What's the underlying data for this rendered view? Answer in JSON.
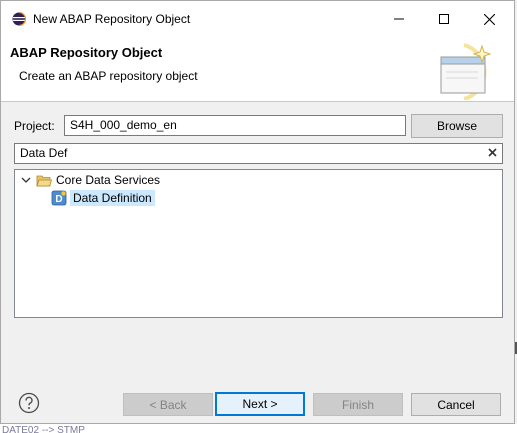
{
  "window": {
    "title": "New ABAP Repository Object"
  },
  "banner": {
    "heading": "ABAP Repository Object",
    "subtitle": "Create an ABAP repository object"
  },
  "project": {
    "label": "Project:",
    "value": "S4H_000_demo_en",
    "browse_label": "Browse"
  },
  "filter": {
    "value": "Data Def",
    "clear_icon": "clear-x-icon"
  },
  "tree": {
    "folder": {
      "label": "Core Data Services",
      "icon": "folder-open-icon",
      "expanded": true
    },
    "item": {
      "label": "Data Definition",
      "icon": "data-definition-icon",
      "selected": true
    }
  },
  "buttons": {
    "back": "< Back",
    "next": "Next >",
    "finish": "Finish",
    "cancel": "Cancel"
  },
  "background": {
    "bottom_text": "DATE02  -->  STMP"
  },
  "colors": {
    "selection": "#cce8ff",
    "default_button_border": "#0078d7"
  }
}
